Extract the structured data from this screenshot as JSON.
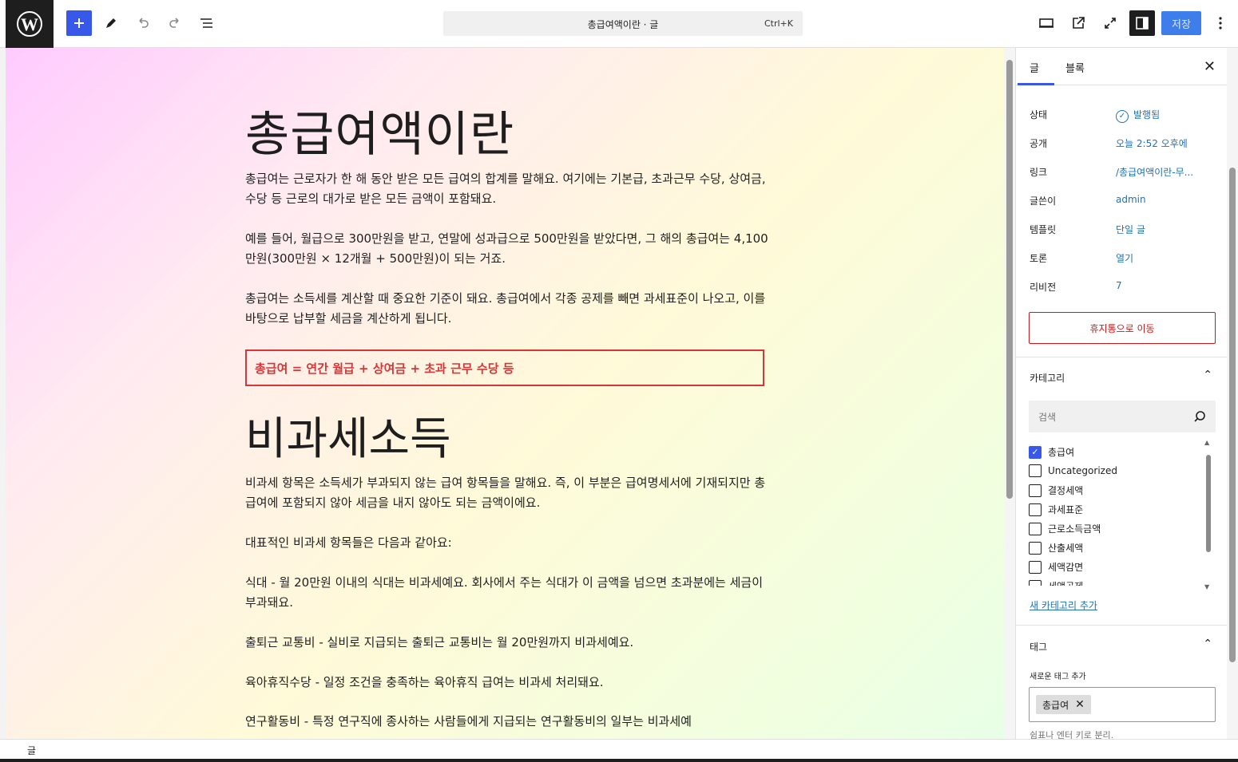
{
  "topbar": {
    "command_title": "총급여액이란 · 글",
    "command_shortcut": "Ctrl+K",
    "save_label": "저장"
  },
  "post": {
    "title": "총급여액이란",
    "paragraphs": [
      "총급여는 근로자가 한 해 동안 받은 모든 급여의 합계를 말해요. 여기에는 기본급, 초과근무 수당, 상여금, 수당 등 근로의 대가로 받은 모든 금액이 포함돼요.",
      "예를 들어, 월급으로 300만원을 받고, 연말에 성과급으로 500만원을 받았다면, 그 해의 총급여는 4,100만원(300만원 × 12개월 + 500만원)이 되는 거죠.",
      "총급여는 소득세를 계산할 때 중요한 기준이 돼요. 총급여에서 각종 공제를 빼면 과세표준이 나오고, 이를 바탕으로 납부할 세금을 계산하게 됩니다."
    ],
    "formula": "총급여 = 연간 월급 + 상여금 + 초과 근무 수당 등",
    "heading2": "비과세소득",
    "paragraphs2": [
      "비과세 항목은 소득세가 부과되지 않는 급여 항목들을 말해요. 즉, 이 부분은 급여명세서에 기재되지만 총급여에 포함되지 않아 세금을 내지 않아도 되는 금액이에요.",
      "대표적인 비과세 항목들은 다음과 같아요:",
      "식대 - 월 20만원 이내의 식대는 비과세예요. 회사에서 주는 식대가 이 금액을 넘으면 초과분에는 세금이 부과돼요.",
      "출퇴근 교통비 - 실비로 지급되는 출퇴근 교통비는 월 20만원까지 비과세예요.",
      "육아휴직수당 - 일정 조건을 충족하는 육아휴직 급여는 비과세 처리돼요.",
      "연구활동비 - 특정 연구직에 종사하는 사람들에게 지급되는 연구활동비의 일부는 비과세예"
    ]
  },
  "sidebar": {
    "tab_post": "글",
    "tab_block": "블록",
    "rows": [
      {
        "label": "상태",
        "value": "발행됨"
      },
      {
        "label": "공개",
        "value": "오늘 2:52 오후에"
      },
      {
        "label": "링크",
        "value": "/총급여액이란-무..."
      },
      {
        "label": "글쓴이",
        "value": "admin"
      },
      {
        "label": "템플릿",
        "value": "단일 글"
      },
      {
        "label": "토론",
        "value": "열기"
      },
      {
        "label": "리비전",
        "value": "7"
      }
    ],
    "trash_label": "휴지통으로 이동",
    "category_title": "카테고리",
    "category_search_placeholder": "검색",
    "categories": [
      {
        "label": "총급여",
        "checked": true
      },
      {
        "label": "Uncategorized",
        "checked": false
      },
      {
        "label": "결정세액",
        "checked": false
      },
      {
        "label": "과세표준",
        "checked": false
      },
      {
        "label": "근로소득금액",
        "checked": false
      },
      {
        "label": "산출세액",
        "checked": false
      },
      {
        "label": "세액감면",
        "checked": false
      },
      {
        "label": "세액공제",
        "checked": false
      }
    ],
    "new_category_label": "새 카테고리 추가",
    "tag_title": "태그",
    "tag_input_label": "새로운 태그 추가",
    "tag_chip": "총급여",
    "tag_help": "쉼표나 엔터 키로 분리."
  },
  "footer": {
    "breadcrumb": "글"
  },
  "colors": {
    "accent": "#3858e9",
    "save_button": "#3d7eea",
    "danger": "#d63638",
    "link": "#2271b1"
  }
}
